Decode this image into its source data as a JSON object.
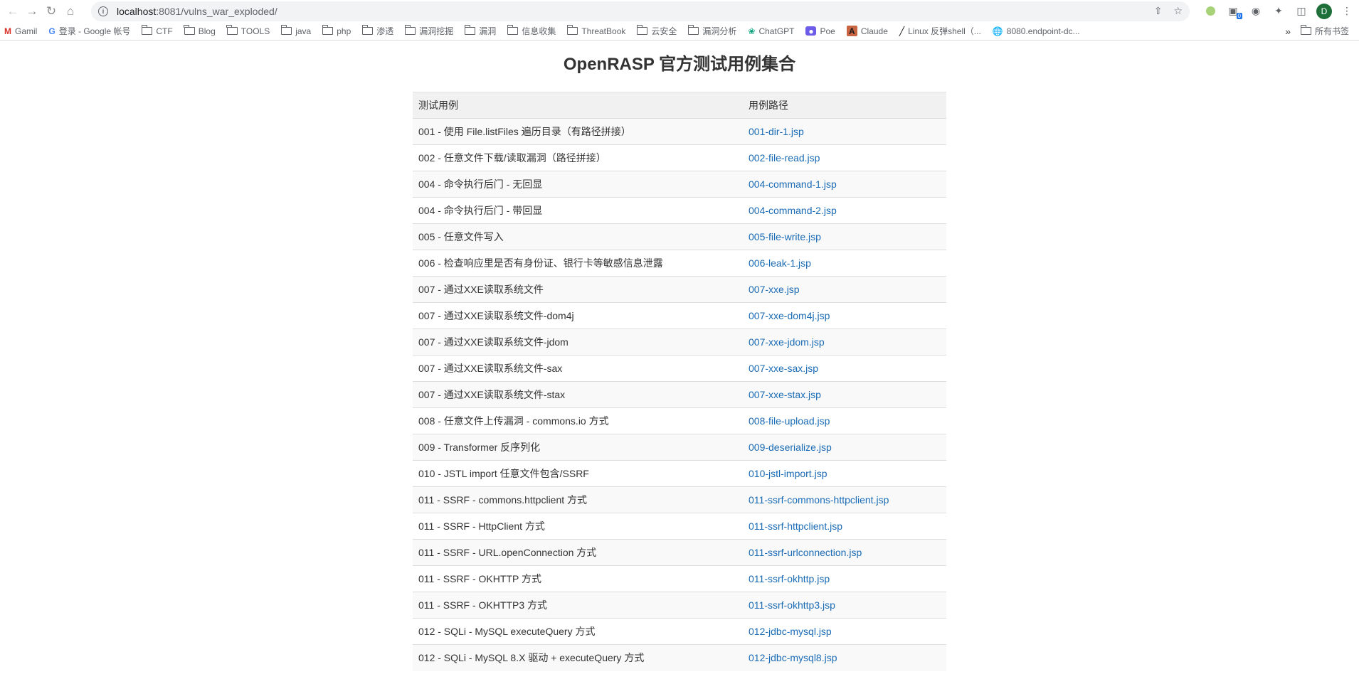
{
  "browser": {
    "url_host": "localhost",
    "url_path": ":8081/vulns_war_exploded/",
    "extension_badge": "0",
    "profile_initial": "D"
  },
  "bookmarks": [
    {
      "label": "Gamil",
      "icon": "gmail-icon"
    },
    {
      "label": "登录 - Google 帐号",
      "icon": "google-icon"
    },
    {
      "label": "CTF",
      "icon": "folder-icon"
    },
    {
      "label": "Blog",
      "icon": "folder-icon"
    },
    {
      "label": "TOOLS",
      "icon": "folder-icon"
    },
    {
      "label": "java",
      "icon": "folder-icon"
    },
    {
      "label": "php",
      "icon": "folder-icon"
    },
    {
      "label": "渗透",
      "icon": "folder-icon"
    },
    {
      "label": "漏洞挖掘",
      "icon": "folder-icon"
    },
    {
      "label": "漏洞",
      "icon": "folder-icon"
    },
    {
      "label": "信息收集",
      "icon": "folder-icon"
    },
    {
      "label": "ThreatBook",
      "icon": "folder-icon"
    },
    {
      "label": "云安全",
      "icon": "folder-icon"
    },
    {
      "label": "漏洞分析",
      "icon": "folder-icon"
    },
    {
      "label": "ChatGPT",
      "icon": "chatgpt-icon"
    },
    {
      "label": "Poe",
      "icon": "poe-icon"
    },
    {
      "label": "Claude",
      "icon": "claude-icon"
    },
    {
      "label": "Linux 反弹shell（...",
      "icon": "linux-icon"
    },
    {
      "label": "8080.endpoint-dc...",
      "icon": "globe-icon"
    }
  ],
  "all_bookmarks_label": "所有书签",
  "page": {
    "title": "OpenRASP 官方测试用例集合",
    "headers": {
      "case": "测试用例",
      "path": "用例路径"
    },
    "rows": [
      {
        "case": "001 - 使用 File.listFiles 遍历目录（有路径拼接）",
        "path": "001-dir-1.jsp"
      },
      {
        "case": "002 - 任意文件下载/读取漏洞（路径拼接）",
        "path": "002-file-read.jsp"
      },
      {
        "case": "004 - 命令执行后门 - 无回显",
        "path": "004-command-1.jsp"
      },
      {
        "case": "004 - 命令执行后门 - 带回显",
        "path": "004-command-2.jsp"
      },
      {
        "case": "005 - 任意文件写入",
        "path": "005-file-write.jsp"
      },
      {
        "case": "006 - 检查响应里是否有身份证、银行卡等敏感信息泄露",
        "path": "006-leak-1.jsp"
      },
      {
        "case": "007 - 通过XXE读取系统文件",
        "path": "007-xxe.jsp"
      },
      {
        "case": "007 - 通过XXE读取系统文件-dom4j",
        "path": "007-xxe-dom4j.jsp"
      },
      {
        "case": "007 - 通过XXE读取系统文件-jdom",
        "path": "007-xxe-jdom.jsp"
      },
      {
        "case": "007 - 通过XXE读取系统文件-sax",
        "path": "007-xxe-sax.jsp"
      },
      {
        "case": "007 - 通过XXE读取系统文件-stax",
        "path": "007-xxe-stax.jsp"
      },
      {
        "case": "008 - 任意文件上传漏洞 - commons.io 方式",
        "path": "008-file-upload.jsp"
      },
      {
        "case": "009 - Transformer 反序列化",
        "path": "009-deserialize.jsp"
      },
      {
        "case": "010 - JSTL import 任意文件包含/SSRF",
        "path": "010-jstl-import.jsp"
      },
      {
        "case": "011 - SSRF - commons.httpclient 方式",
        "path": "011-ssrf-commons-httpclient.jsp"
      },
      {
        "case": "011 - SSRF - HttpClient 方式",
        "path": "011-ssrf-httpclient.jsp"
      },
      {
        "case": "011 - SSRF - URL.openConnection 方式",
        "path": "011-ssrf-urlconnection.jsp"
      },
      {
        "case": "011 - SSRF - OKHTTP 方式",
        "path": "011-ssrf-okhttp.jsp"
      },
      {
        "case": "011 - SSRF - OKHTTP3 方式",
        "path": "011-ssrf-okhttp3.jsp"
      },
      {
        "case": "012 - SQLi - MySQL executeQuery 方式",
        "path": "012-jdbc-mysql.jsp"
      },
      {
        "case": "012 - SQLi - MySQL 8.X 驱动 + executeQuery 方式",
        "path": "012-jdbc-mysql8.jsp"
      }
    ]
  }
}
